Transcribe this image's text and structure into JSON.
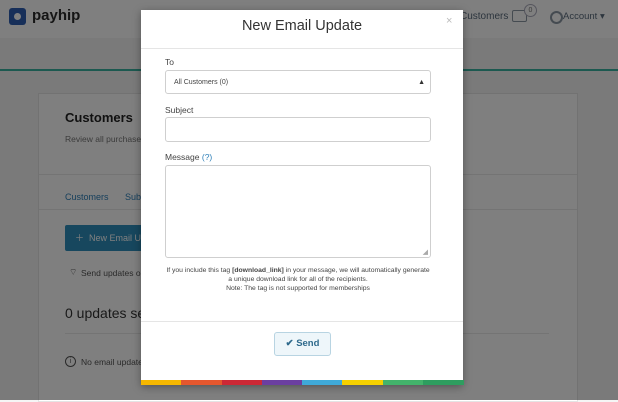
{
  "app": {
    "logo_text": "payhip",
    "nav_customers": "Customers",
    "chat_count": "0",
    "account_label": "Account"
  },
  "page": {
    "title": "Customers",
    "subtitle": "Review all purchases",
    "tabs": [
      "Customers",
      "Subs"
    ],
    "new_button": "New Email U",
    "send_updates_text": "Send updates o",
    "updates_count": "0 updates ser",
    "no_email_text": "No email update"
  },
  "modal": {
    "title": "New Email Update",
    "close": "×",
    "to_label": "To",
    "to_selected": "All Customers (0)",
    "subject_label": "Subject",
    "subject_value": "",
    "message_label": "Message",
    "help_link": "(?)",
    "message_value": "",
    "note_pre": "If you include this tag ",
    "note_tag": "[download_link]",
    "note_post": " in your message, we will automatically generate a unique download link for all of the recipients.",
    "note_line2": "Note: The tag is not supported for memberships",
    "send_label": "Send",
    "stripe_colors": [
      "#f5b700",
      "#e4572e",
      "#cc2936",
      "#6b3fa0",
      "#3fa9d8",
      "#f5d000",
      "#43b36b",
      "#2e9d5f"
    ]
  }
}
